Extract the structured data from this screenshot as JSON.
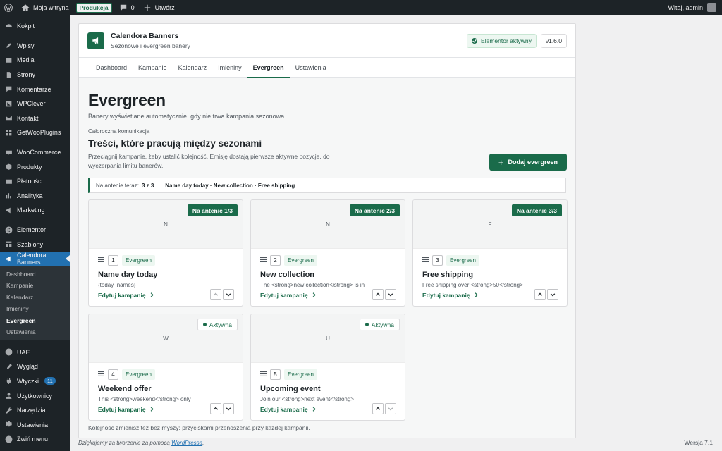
{
  "adminbar": {
    "site_name": "Moja witryna",
    "env": "Produkcja",
    "comments": "0",
    "new": "Utwórz",
    "greeting": "Witaj, admin"
  },
  "sidebar": {
    "group1": [
      "Kokpit"
    ],
    "group2": [
      "Wpisy",
      "Media",
      "Strony",
      "Komentarze",
      "WPClever",
      "Kontakt",
      "GetWooPlugins"
    ],
    "group3": [
      "WooCommerce",
      "Produkty",
      "Płatności",
      "Analityka",
      "Marketing"
    ],
    "group4": [
      "Elementor",
      "Szablony"
    ],
    "active": "Calendora Banners",
    "submenu": [
      "Dashboard",
      "Kampanie",
      "Kalendarz",
      "Imieniny",
      "Evergreen",
      "Ustawienia"
    ],
    "submenu_current": "Evergreen",
    "group5": [
      "UAE",
      "Wygląd"
    ],
    "plugins_label": "Wtyczki",
    "plugins_badge": "11",
    "group6": [
      "Użytkownicy",
      "Narzędzia",
      "Ustawienia",
      "Zwiń menu"
    ]
  },
  "plugin": {
    "name": "Calendora Banners",
    "tagline": "Sezonowe i evergreen banery",
    "elementor_status": "Elementor aktywny",
    "version": "v1.6.0"
  },
  "tabs": [
    "Dashboard",
    "Kampanie",
    "Kalendarz",
    "Imieniny",
    "Evergreen",
    "Ustawienia"
  ],
  "active_tab": "Evergreen",
  "page": {
    "title": "Evergreen",
    "description": "Banery wyświetlane automatycznie, gdy nie trwa kampania sezonowa.",
    "eyebrow": "Całoroczna komunikacja",
    "section_title": "Treści, które pracują między sezonami",
    "section_desc": "Przeciągnij kampanie, żeby ustalić kolejność. Emisję dostają pierwsze aktywne pozycje, do wyczerpania limitu banerów.",
    "add_button": "Dodaj evergreen",
    "on_air_label": "Na antenie teraz:",
    "on_air_count": "3 z 3",
    "on_air_list": "Name day today · New collection · Free shipping",
    "hint": "Kolejność zmienisz też bez myszy: przyciskami przenoszenia przy każdej kampanii."
  },
  "cards": [
    {
      "preview": "N",
      "status": "Na antenie 1/3",
      "live": true,
      "num": "1",
      "tag": "Evergreen",
      "title": "Name day today",
      "text": "{today_names}",
      "edit": "Edytuj kampanię"
    },
    {
      "preview": "N",
      "status": "Na antenie 2/3",
      "live": true,
      "num": "2",
      "tag": "Evergreen",
      "title": "New collection",
      "text": "The <strong>new collection</strong> is in",
      "edit": "Edytuj kampanię"
    },
    {
      "preview": "F",
      "status": "Na antenie 3/3",
      "live": true,
      "num": "3",
      "tag": "Evergreen",
      "title": "Free shipping",
      "text": "Free shipping over <strong>50</strong>",
      "edit": "Edytuj kampanię"
    },
    {
      "preview": "W",
      "status": "Aktywna",
      "live": false,
      "num": "4",
      "tag": "Evergreen",
      "title": "Weekend offer",
      "text": "This <strong>weekend</strong> only",
      "edit": "Edytuj kampanię"
    },
    {
      "preview": "U",
      "status": "Aktywna",
      "live": false,
      "num": "5",
      "tag": "Evergreen",
      "title": "Upcoming event",
      "text": "Join our <strong>next event</strong>",
      "edit": "Edytuj kampanię"
    }
  ],
  "footer": {
    "thanks_prefix": "Dziękujemy za tworzenie za pomocą",
    "wordpress": "WordPressa",
    "thanks_suffix": ".",
    "version": "Wersja 7.1"
  },
  "colors": {
    "brand": "#1a6b4a",
    "wp_blue": "#2271b1",
    "adminbar": "#1d2327"
  }
}
